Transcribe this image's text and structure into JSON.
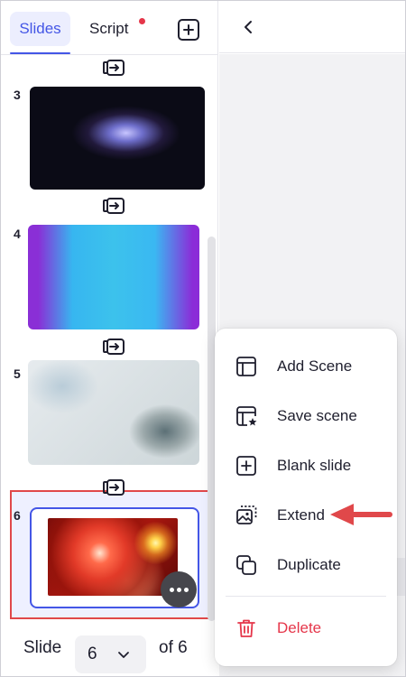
{
  "tabs": {
    "slides_label": "Slides",
    "script_label": "Script"
  },
  "slides": [
    {
      "number": "3"
    },
    {
      "number": "4"
    },
    {
      "number": "5"
    },
    {
      "number": "6"
    }
  ],
  "footer": {
    "slide_label": "Slide",
    "current_page": "6",
    "of_label": "of 6"
  },
  "context_menu": {
    "items": [
      {
        "label": "Add Scene",
        "icon": "layout-icon"
      },
      {
        "label": "Save scene",
        "icon": "save-scene-icon"
      },
      {
        "label": "Blank slide",
        "icon": "plus-square-icon"
      },
      {
        "label": "Extend",
        "icon": "extend-image-icon"
      },
      {
        "label": "Duplicate",
        "icon": "duplicate-icon"
      },
      {
        "label": "Delete",
        "icon": "trash-icon"
      }
    ]
  },
  "colors": {
    "accent": "#4456e6",
    "notification_dot": "#e5364a",
    "delete": "#e5364a",
    "annotation": "#e0484a"
  }
}
